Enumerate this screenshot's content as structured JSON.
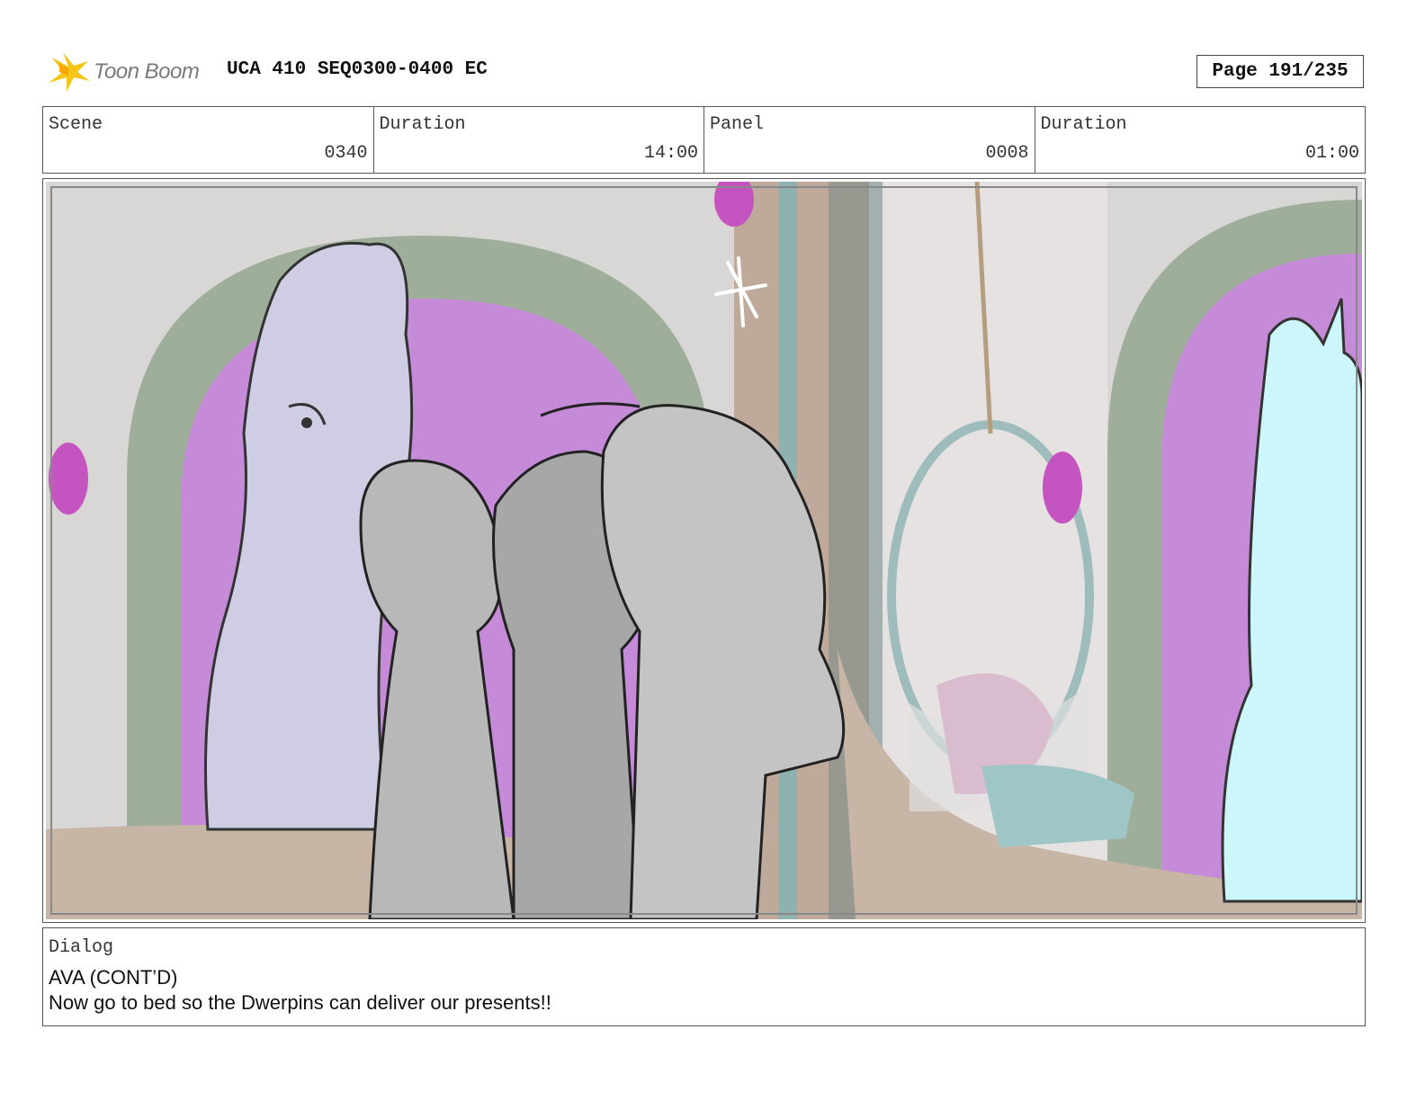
{
  "header": {
    "logo_text": "Toon Boom",
    "title": "UCA 410 SEQ0300-0400 EC",
    "page": "Page 191/235"
  },
  "info": [
    {
      "label": "Scene",
      "value": "0340"
    },
    {
      "label": "Duration",
      "value": "14:00"
    },
    {
      "label": "Panel",
      "value": "0008"
    },
    {
      "label": "Duration",
      "value": "01:00"
    }
  ],
  "dialog": {
    "label": "Dialog",
    "character": "AVA (CONT’D)",
    "line": "Now go to bed so the Dwerpins can deliver our presents!!"
  },
  "colors": {
    "logo_star": "#f5c518",
    "arch_green": "#9fae9b",
    "arch_purple": "#c58ad8",
    "wall": "#d9d6d6",
    "floor": "#c7b5a6",
    "horse_left": "#cfcde3",
    "unicorn_right": "#cdf6fa",
    "figure_gray": "#b8b8b8"
  }
}
